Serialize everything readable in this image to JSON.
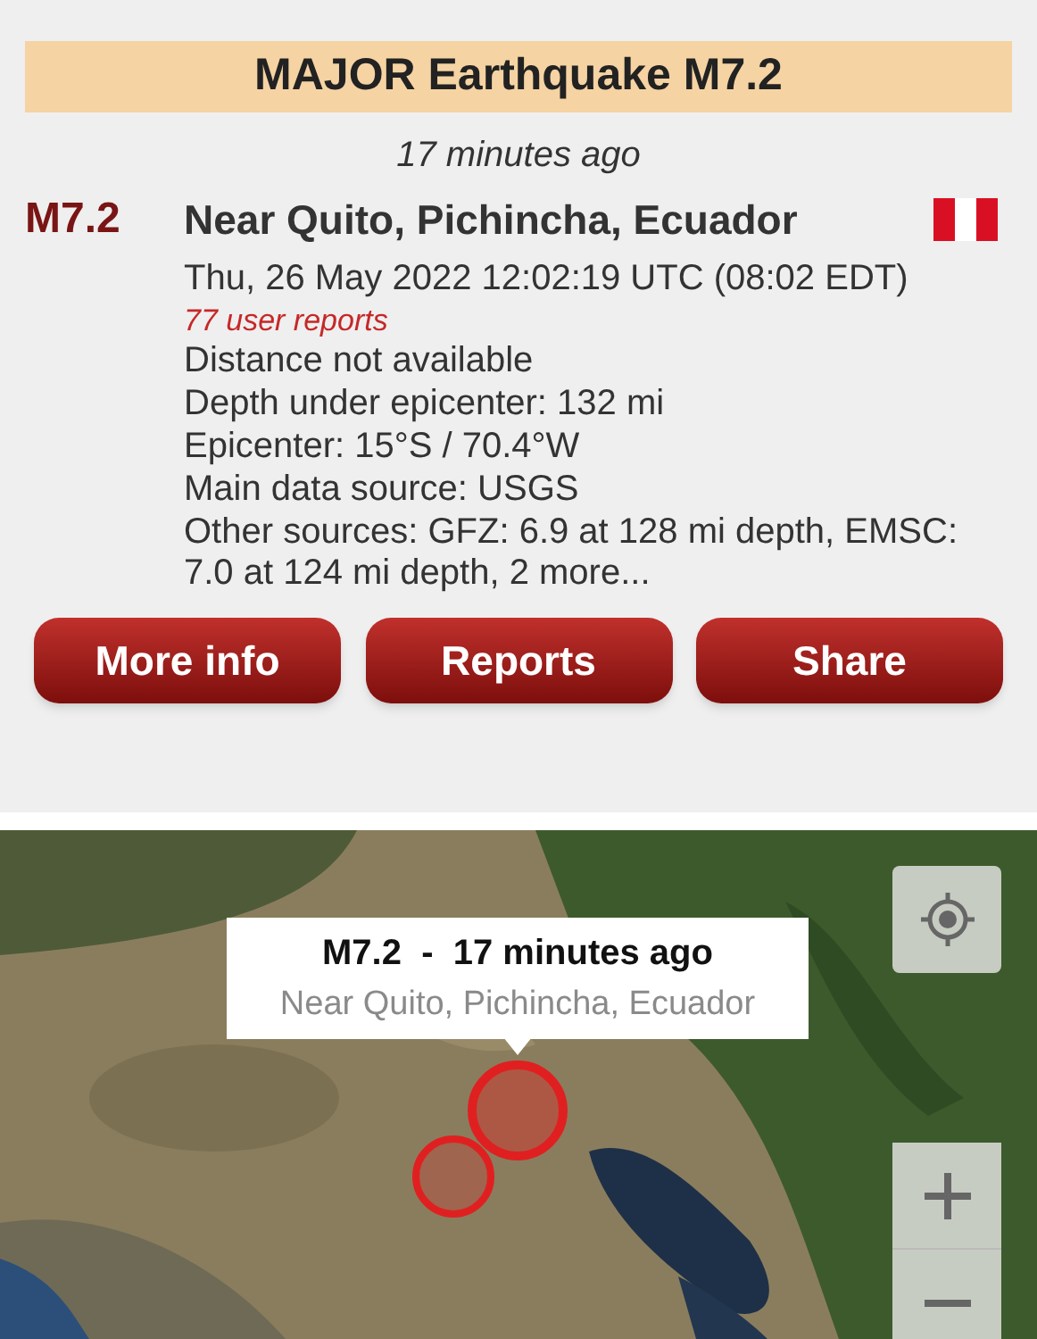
{
  "header": {
    "title": "MAJOR Earthquake M7.2"
  },
  "time_ago": "17 minutes ago",
  "quake": {
    "magnitude": "M7.2",
    "location": "Near Quito, Pichincha, Ecuador"
  },
  "details": [
    {
      "kind": "plain",
      "text": "Thu, 26 May 2022 12:02:19 UTC (08:02 EDT)"
    },
    {
      "kind": "reports",
      "text": "77 user reports"
    },
    {
      "kind": "plain",
      "text": "Distance not available"
    },
    {
      "kind": "plain",
      "text": "Depth under epicenter: 132 mi"
    },
    {
      "kind": "plain",
      "text": "Epicenter: 15°S / 70.4°W"
    },
    {
      "kind": "plain",
      "text": "Main data source: USGS"
    },
    {
      "kind": "plain",
      "text": "Other sources: GFZ: 6.9 at 128 mi depth, EMSC: 7.0 at 124 mi depth, 2 more..."
    }
  ],
  "buttons": [
    "More info",
    "Reports",
    "Share"
  ],
  "map": {
    "popup": {
      "title": "M7.2  -  17 minutes ago",
      "subtitle": "Near Quito, Pichincha, Ecuador"
    }
  }
}
